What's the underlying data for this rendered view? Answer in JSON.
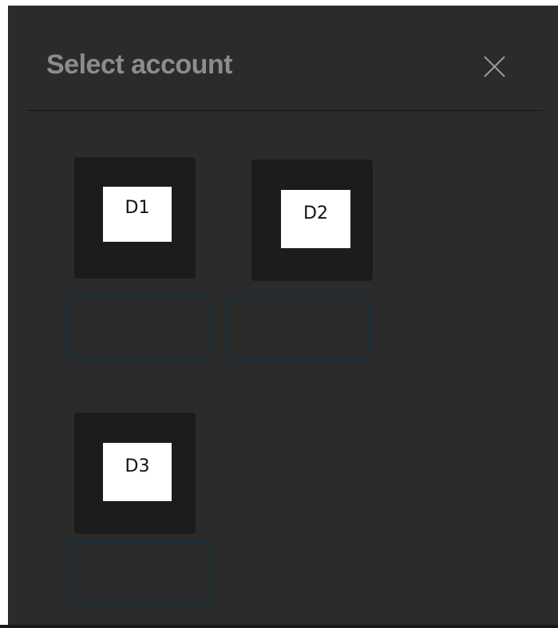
{
  "dialog": {
    "title": "Select account",
    "close_icon": "close-icon"
  },
  "accounts": [
    {
      "initials": "D1",
      "label": ""
    },
    {
      "initials": "D2",
      "label": ""
    },
    {
      "initials": "D3",
      "label": ""
    }
  ],
  "colors": {
    "background": "#2b2b2b",
    "tile": "#1c1c1c",
    "title": "#8c8c8c",
    "label_border": "#16303e",
    "avatar": "#ffffff"
  }
}
